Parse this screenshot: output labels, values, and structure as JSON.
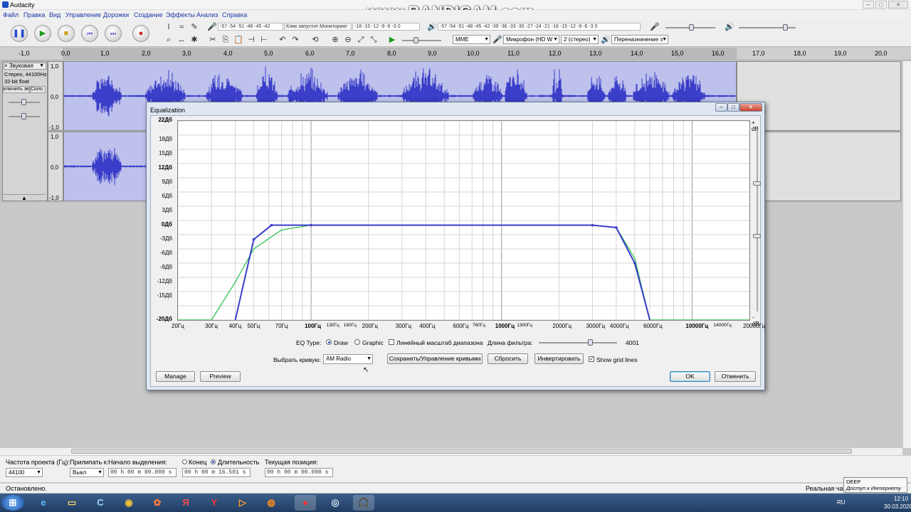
{
  "window": {
    "title": "Audacity"
  },
  "watermark": "www.BANDICAM.com",
  "menu": [
    "Файл",
    "Правка",
    "Вид",
    "Управление",
    "Дорожки",
    "Создание",
    "Эффекты",
    "Анализ",
    "Справка"
  ],
  "toolbar": {
    "meter_play_ticks": "-57 -54 -51 -48 -45 -42",
    "meter_play_hint": "Клик запустит Мониторинг",
    "meter_play_ticks2": "-18 -15 -12 -9 -6 -3 0",
    "meter_rec_ticks": "-57 -54 -51 -48 -45 -42 -39 -36 -33 -30 -27 -24 -21 -18 -15 -12 -9 -6 -3 0",
    "host": "MME",
    "input_device": "Микрофон (HD W",
    "channels": "2 (стерео)",
    "output_device": "Переназначение з"
  },
  "ruler": {
    "ticks": [
      "-1,0",
      "0,0",
      "1,0",
      "2,0",
      "3,0",
      "4,0",
      "5,0",
      "6,0",
      "7,0",
      "8,0",
      "9,0",
      "10,0",
      "11,0",
      "12,0",
      "13,0",
      "14,0",
      "15,0",
      "16,0",
      "17,0",
      "18,0",
      "19,0",
      "20,0"
    ]
  },
  "track": {
    "name": "Звуковая",
    "info": [
      "Стерео, 44100Hz",
      "32-bit float"
    ],
    "mute_solo": "ключить звук",
    "solo": "Соло",
    "scale_top": [
      "1,0",
      "0,0",
      "-1,0"
    ],
    "scale_bottom": [
      "1,0",
      "0,0",
      "-1,0"
    ]
  },
  "dialog": {
    "title": "Equalization",
    "db_top_label": "+ dB",
    "db_bottom_label": "- dB",
    "db_labels": [
      "22Дб",
      "18Дб",
      "15Дб",
      "12Дб",
      "9Дб",
      "6Дб",
      "3Дб",
      "0Дб",
      "-3Дб",
      "-6Дб",
      "-9Дб",
      "-12Дб",
      "-15Дб",
      "-20Дб"
    ],
    "hz_labels": [
      "20Гц",
      "30Гц",
      "40Гц",
      "50Гц",
      "70Гц",
      "100Гц",
      "130Гц",
      "160Гц",
      "200Гц",
      "300Гц",
      "400Гц",
      "600Гц",
      "760Гц",
      "1000Гц",
      "1300Гц",
      "2000Гц",
      "3000Гц",
      "4000Гц",
      "6000Гц",
      "10000Гц",
      "14000Гц",
      "20000Гц"
    ],
    "eq_type_label": "EQ Type:",
    "eq_draw": "Draw",
    "eq_graphic": "Graphic",
    "linear_scale_label": "Линейный масштаб диапазона",
    "filter_length_label": "Длина фильтра:",
    "filter_length_value": "4001",
    "filter_length_fraction": 0.65,
    "curve_label": "Выбрать кривую:",
    "curve_value": "AM Radio",
    "save_manage_label": "Сохранить/Управление кривыми",
    "reset_label": "Сбросить",
    "invert_label": "Инвертировать",
    "grid_label": "Show grid lines",
    "manage_label": "Manage",
    "preview_label": "Preview",
    "ok_label": "OK",
    "cancel_label": "Отменить"
  },
  "bottom": {
    "rate_label": "Частота проекта (Гц):",
    "rate_value": "44100",
    "snap_label": "Прилипать к:",
    "snap_value": "Выкл",
    "sel_start_label": "Начало выделения:",
    "end_label": "Конец",
    "length_label": "Длительность",
    "sel_start_value": "00 h 00 m 00.000 s",
    "sel_length_value": "00 h 00 m 16.501 s",
    "position_label": "Текущая позиция:",
    "position_value": "00 h 00 m 00.000 s"
  },
  "status": {
    "left": "Остановлено.",
    "right": "Реальная частс"
  },
  "tooltip": {
    "line1": "DEEP",
    "line2": "Доступ к Интернету"
  },
  "tray": {
    "lang": "RU",
    "time": "12:10",
    "date": "30.03.2020"
  },
  "colors": {
    "waveform": "#3a3ec8",
    "eq_curve": "#3a3ec8",
    "eq_ref_curve": "#22c04a",
    "selection_bg": "#bec1ec"
  }
}
